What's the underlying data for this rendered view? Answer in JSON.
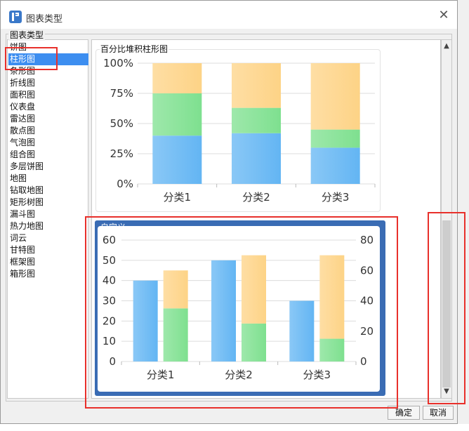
{
  "window": {
    "title": "图表类型",
    "close_glyph": "✕"
  },
  "group_label": "图表类型",
  "chart_types": [
    "饼图",
    "柱形图",
    "条形图",
    "折线图",
    "面积图",
    "仪表盘",
    "雷达图",
    "散点图",
    "气泡图",
    "组合图",
    "多层饼图",
    "地图",
    "钻取地图",
    "矩形树图",
    "漏斗图",
    "热力地图",
    "词云",
    "甘特图",
    "框架图",
    "箱形图"
  ],
  "selected_index": 1,
  "preview1": {
    "label": "百分比堆积柱形图",
    "chart_data": {
      "type": "bar",
      "stacked": "percent",
      "categories": [
        "分类1",
        "分类2",
        "分类3"
      ],
      "series": [
        {
          "values": [
            40,
            42,
            30
          ],
          "color": "#63b5f3"
        },
        {
          "values": [
            35,
            21,
            15
          ],
          "color": "#7ee08f"
        },
        {
          "values": [
            25,
            37,
            55
          ],
          "color": "#fdd386"
        }
      ],
      "ylim": [
        0,
        100
      ],
      "yticks": [
        "0%",
        "25%",
        "50%",
        "75%",
        "100%"
      ],
      "grid": true
    }
  },
  "preview2": {
    "label": "自定义",
    "chart_data": {
      "type": "bar",
      "categories": [
        "分类1",
        "分类2",
        "分类3"
      ],
      "left_axis": {
        "ylim": [
          0,
          60
        ],
        "yticks": [
          "0",
          "10",
          "20",
          "30",
          "40",
          "50",
          "60"
        ]
      },
      "right_axis": {
        "ylim": [
          0,
          80
        ],
        "yticks": [
          "0",
          "20",
          "40",
          "60",
          "80"
        ]
      },
      "series": [
        {
          "axis": "left",
          "values": [
            40,
            50,
            30
          ],
          "color": "#63b5f3"
        },
        {
          "axis": "right",
          "stacked": true,
          "values": [
            35,
            25,
            15
          ],
          "color": "#7ee08f"
        },
        {
          "axis": "right",
          "stacked": true,
          "values": [
            25,
            45,
            55
          ],
          "color": "#fdd386"
        }
      ],
      "grid": true
    }
  },
  "buttons": {
    "ok": "确定",
    "cancel": "取消"
  },
  "scroll": {
    "up": "▲",
    "down": "▼"
  },
  "colors": {
    "selected": "#3d8ef0",
    "highlight": "#e8302b",
    "custom_frame": "#3a6cb4"
  }
}
